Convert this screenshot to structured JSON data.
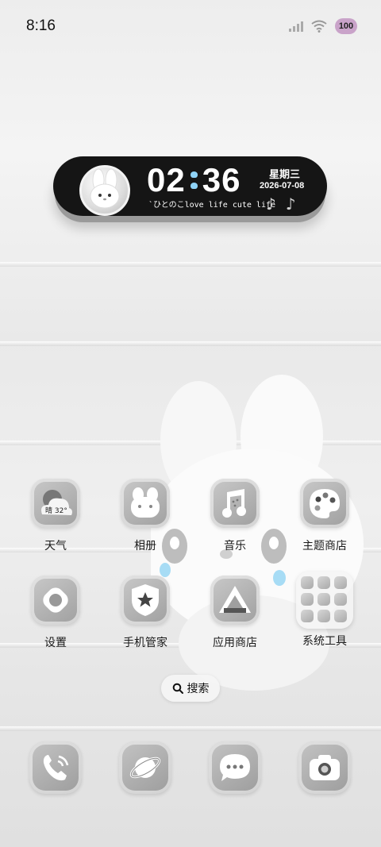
{
  "status_bar": {
    "time": "8:16",
    "battery": "100"
  },
  "widget": {
    "hour": "02",
    "minute": "36",
    "weekday": "星期三",
    "date": "2026-07-08",
    "tagline": "`ひとのこlove life cute life"
  },
  "apps": [
    {
      "label": "天气",
      "icon": "weather-icon",
      "weather_text": "晴 32°"
    },
    {
      "label": "相册",
      "icon": "gallery-icon"
    },
    {
      "label": "音乐",
      "icon": "music-icon"
    },
    {
      "label": "主题商店",
      "icon": "palette-icon"
    },
    {
      "label": "设置",
      "icon": "gear-icon"
    },
    {
      "label": "手机管家",
      "icon": "shield-icon"
    },
    {
      "label": "应用商店",
      "icon": "app-store-icon"
    },
    {
      "label": "系统工具",
      "icon": "folder-icon"
    }
  ],
  "search": {
    "label": "搜索"
  },
  "dock": [
    {
      "icon": "phone-icon"
    },
    {
      "icon": "browser-icon"
    },
    {
      "icon": "messages-icon"
    },
    {
      "icon": "camera-icon"
    }
  ],
  "colors": {
    "widget_bg": "#151515",
    "heart_accent": "#8fd3f7",
    "battery_badge": "#c9a3c9"
  }
}
